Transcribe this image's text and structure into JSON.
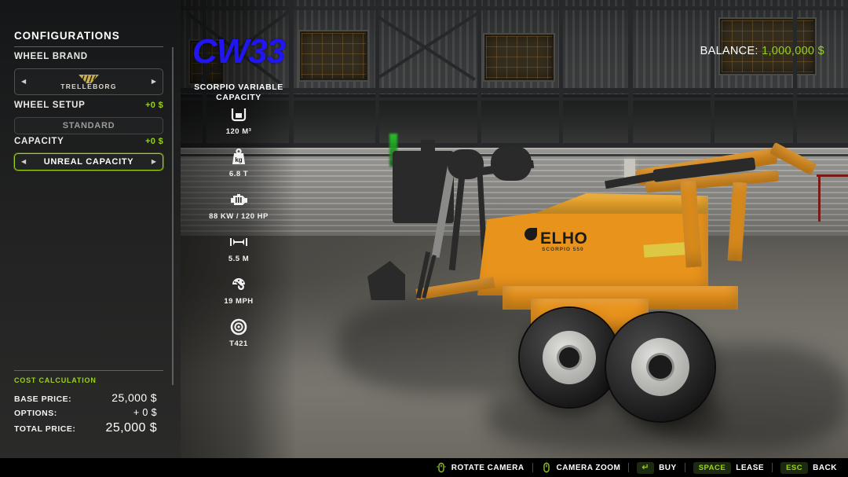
{
  "panel": {
    "title": "CONFIGURATIONS",
    "options": [
      {
        "label": "WHEEL BRAND",
        "price": "",
        "value": "TRELLEBORG",
        "brand_logo": "trelleborg-logo",
        "arrows": true,
        "active": false
      },
      {
        "label": "WHEEL SETUP",
        "price": "+0 $",
        "value": "STANDARD",
        "arrows": false,
        "active": false
      },
      {
        "label": "CAPACITY",
        "price": "+0 $",
        "value": "UNREAL CAPACITY",
        "arrows": true,
        "active": true
      }
    ],
    "cost": {
      "title": "COST CALCULATION",
      "rows": [
        {
          "key": "BASE PRICE:",
          "value": "25,000 $"
        },
        {
          "key": "OPTIONS:",
          "value": "+ 0 $"
        },
        {
          "key": "TOTAL PRICE:",
          "value": "25,000 $"
        }
      ]
    },
    "arrow_left": "◀",
    "arrow_right": "▶"
  },
  "vehicle": {
    "name": "CW33",
    "subtitle": "SCORPIO VARIABLE CAPACITY",
    "brand_text": "ELHO",
    "brand_sub": "SCORPIO 550",
    "stats": [
      {
        "icon": "capacity-icon",
        "value": "120 M³"
      },
      {
        "icon": "weight-icon",
        "value": "6.8 T"
      },
      {
        "icon": "engine-icon",
        "value": "88 KW / 120 HP"
      },
      {
        "icon": "width-icon",
        "value": "5.5 M"
      },
      {
        "icon": "speed-icon",
        "value": "19 MPH"
      },
      {
        "icon": "tire-icon",
        "value": "T421"
      }
    ]
  },
  "balance": {
    "label": "BALANCE:",
    "value": "1,000,000 $"
  },
  "bottom_bar": {
    "items": [
      {
        "icon": "mouse-icon",
        "key": "",
        "label": "ROTATE CAMERA"
      },
      {
        "icon": "mouse-icon",
        "key": "",
        "label": "CAMERA ZOOM"
      },
      {
        "icon": "enter-icon",
        "key": "↵",
        "label": "BUY"
      },
      {
        "icon": "",
        "key": "SPACE",
        "label": "LEASE"
      },
      {
        "icon": "",
        "key": "ESC",
        "label": "BACK"
      }
    ]
  },
  "colors": {
    "accent_green": "#9ad21b",
    "title_blue": "#2116f2",
    "panel_bg": "#1a1b1c",
    "vehicle_orange": "#E8931C"
  }
}
